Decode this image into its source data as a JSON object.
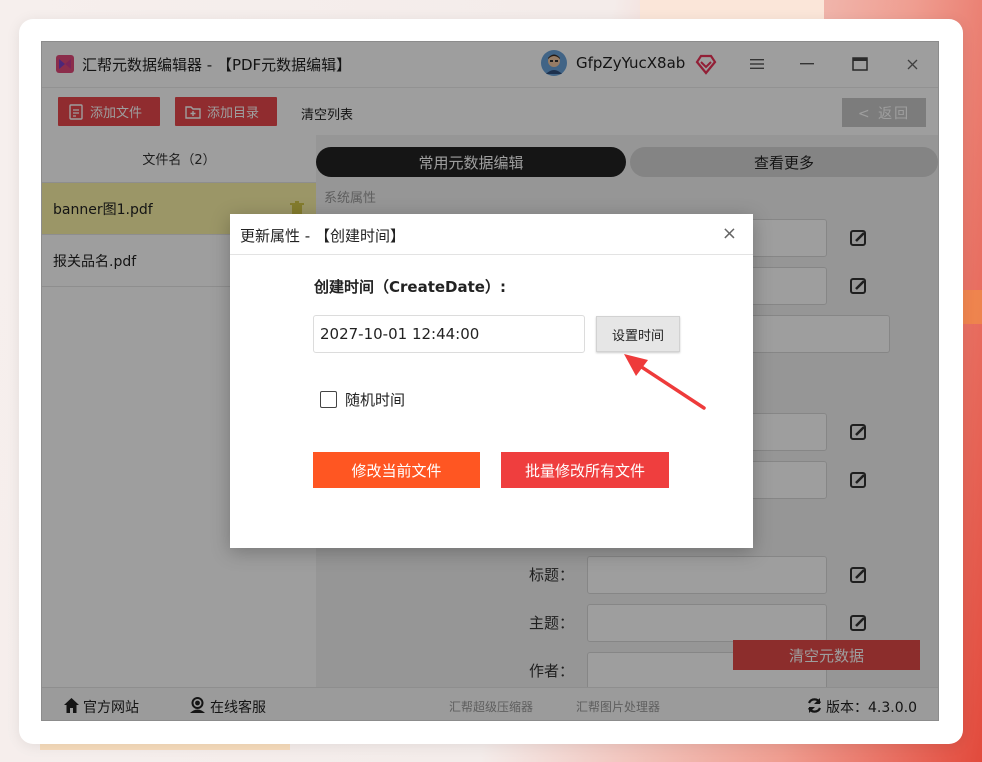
{
  "window": {
    "title": "汇帮元数据编辑器 - 【PDF元数据编辑】",
    "username": "GfpZyYucX8ab",
    "controls": {
      "menu": "≡",
      "minimize": "–",
      "maximize": "□",
      "close": "×"
    }
  },
  "toolbar": {
    "add_file": "添加文件",
    "add_folder": "添加目录",
    "clear_list": "清空列表",
    "back": "< 返回"
  },
  "file_list": {
    "header": "文件名（2）",
    "items": [
      {
        "name": "banner图1.pdf",
        "active": true
      },
      {
        "name": "报关品名.pdf",
        "active": false
      }
    ]
  },
  "tabs": {
    "common": "常用元数据编辑",
    "more": "查看更多"
  },
  "right_panel": {
    "section_system": "系统属性",
    "fields": {
      "title_label": "标题：",
      "subject_label": "主题：",
      "author_label": "作者："
    },
    "clear_metadata": "清空元数据"
  },
  "footer": {
    "website": "官方网站",
    "support": "在线客服",
    "compressor": "汇帮超级压缩器",
    "image_tool": "汇帮图片处理器",
    "version": "版本：4.3.0.0"
  },
  "dialog": {
    "title": "更新属性 - 【创建时间】",
    "close": "×",
    "field_label": "创建时间（CreateDate）:",
    "date_value": "2027-10-01 12:44:00",
    "set_time": "设置时间",
    "random_time": "随机时间",
    "random_checked": false,
    "modify_current": "修改当前文件",
    "modify_all": "批量修改所有文件"
  },
  "colors": {
    "accent_red": "#e8474c",
    "orange": "#ff5622",
    "active_file": "#fbf2a6",
    "arrow": "#ee3b3b"
  }
}
